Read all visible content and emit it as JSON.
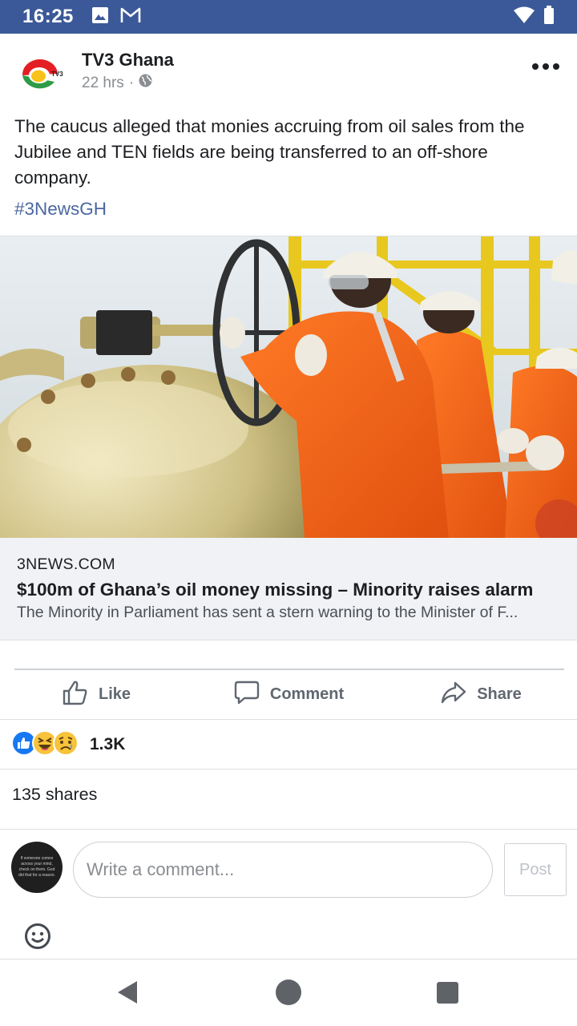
{
  "status_bar": {
    "time": "16:25",
    "left_icons": [
      "image-icon",
      "gmail-icon"
    ],
    "right_icons": [
      "wifi-icon",
      "battery-icon"
    ]
  },
  "post": {
    "page_name": "TV3 Ghana",
    "logo_text": "TV3",
    "time_ago": "22 hrs",
    "separator": "·",
    "privacy_icon": "globe-icon",
    "text": "The caucus alleged that monies accruing from oil sales from the Jubilee and TEN fields are being transferred to an off-shore company.",
    "hashtag": "#3NewsGH"
  },
  "link_preview": {
    "domain": "3NEWS.COM",
    "title": "$100m of Ghana’s oil money missing – Minority raises alarm",
    "description": "The Minority in Parliament has sent a stern warning to the Minister of F..."
  },
  "actions": {
    "like": "Like",
    "comment": "Comment",
    "share": "Share"
  },
  "reactions": {
    "icons": [
      "like-reaction-icon",
      "haha-reaction-icon",
      "sad-reaction-icon"
    ],
    "count": "1.3K"
  },
  "shares": "135 shares",
  "composer": {
    "placeholder": "Write a comment...",
    "post_label": "Post",
    "avatar_text": "If someone comes across your mind, check on them. God did that for a reason."
  },
  "nav_bar": {
    "icons": [
      "back-icon",
      "home-icon",
      "recents-icon"
    ]
  },
  "colors": {
    "status_bar": "#3b5998",
    "hashtag": "#4b67a1",
    "link_preview_bg": "#f0f2f5",
    "like_blue": "#1877f2"
  }
}
